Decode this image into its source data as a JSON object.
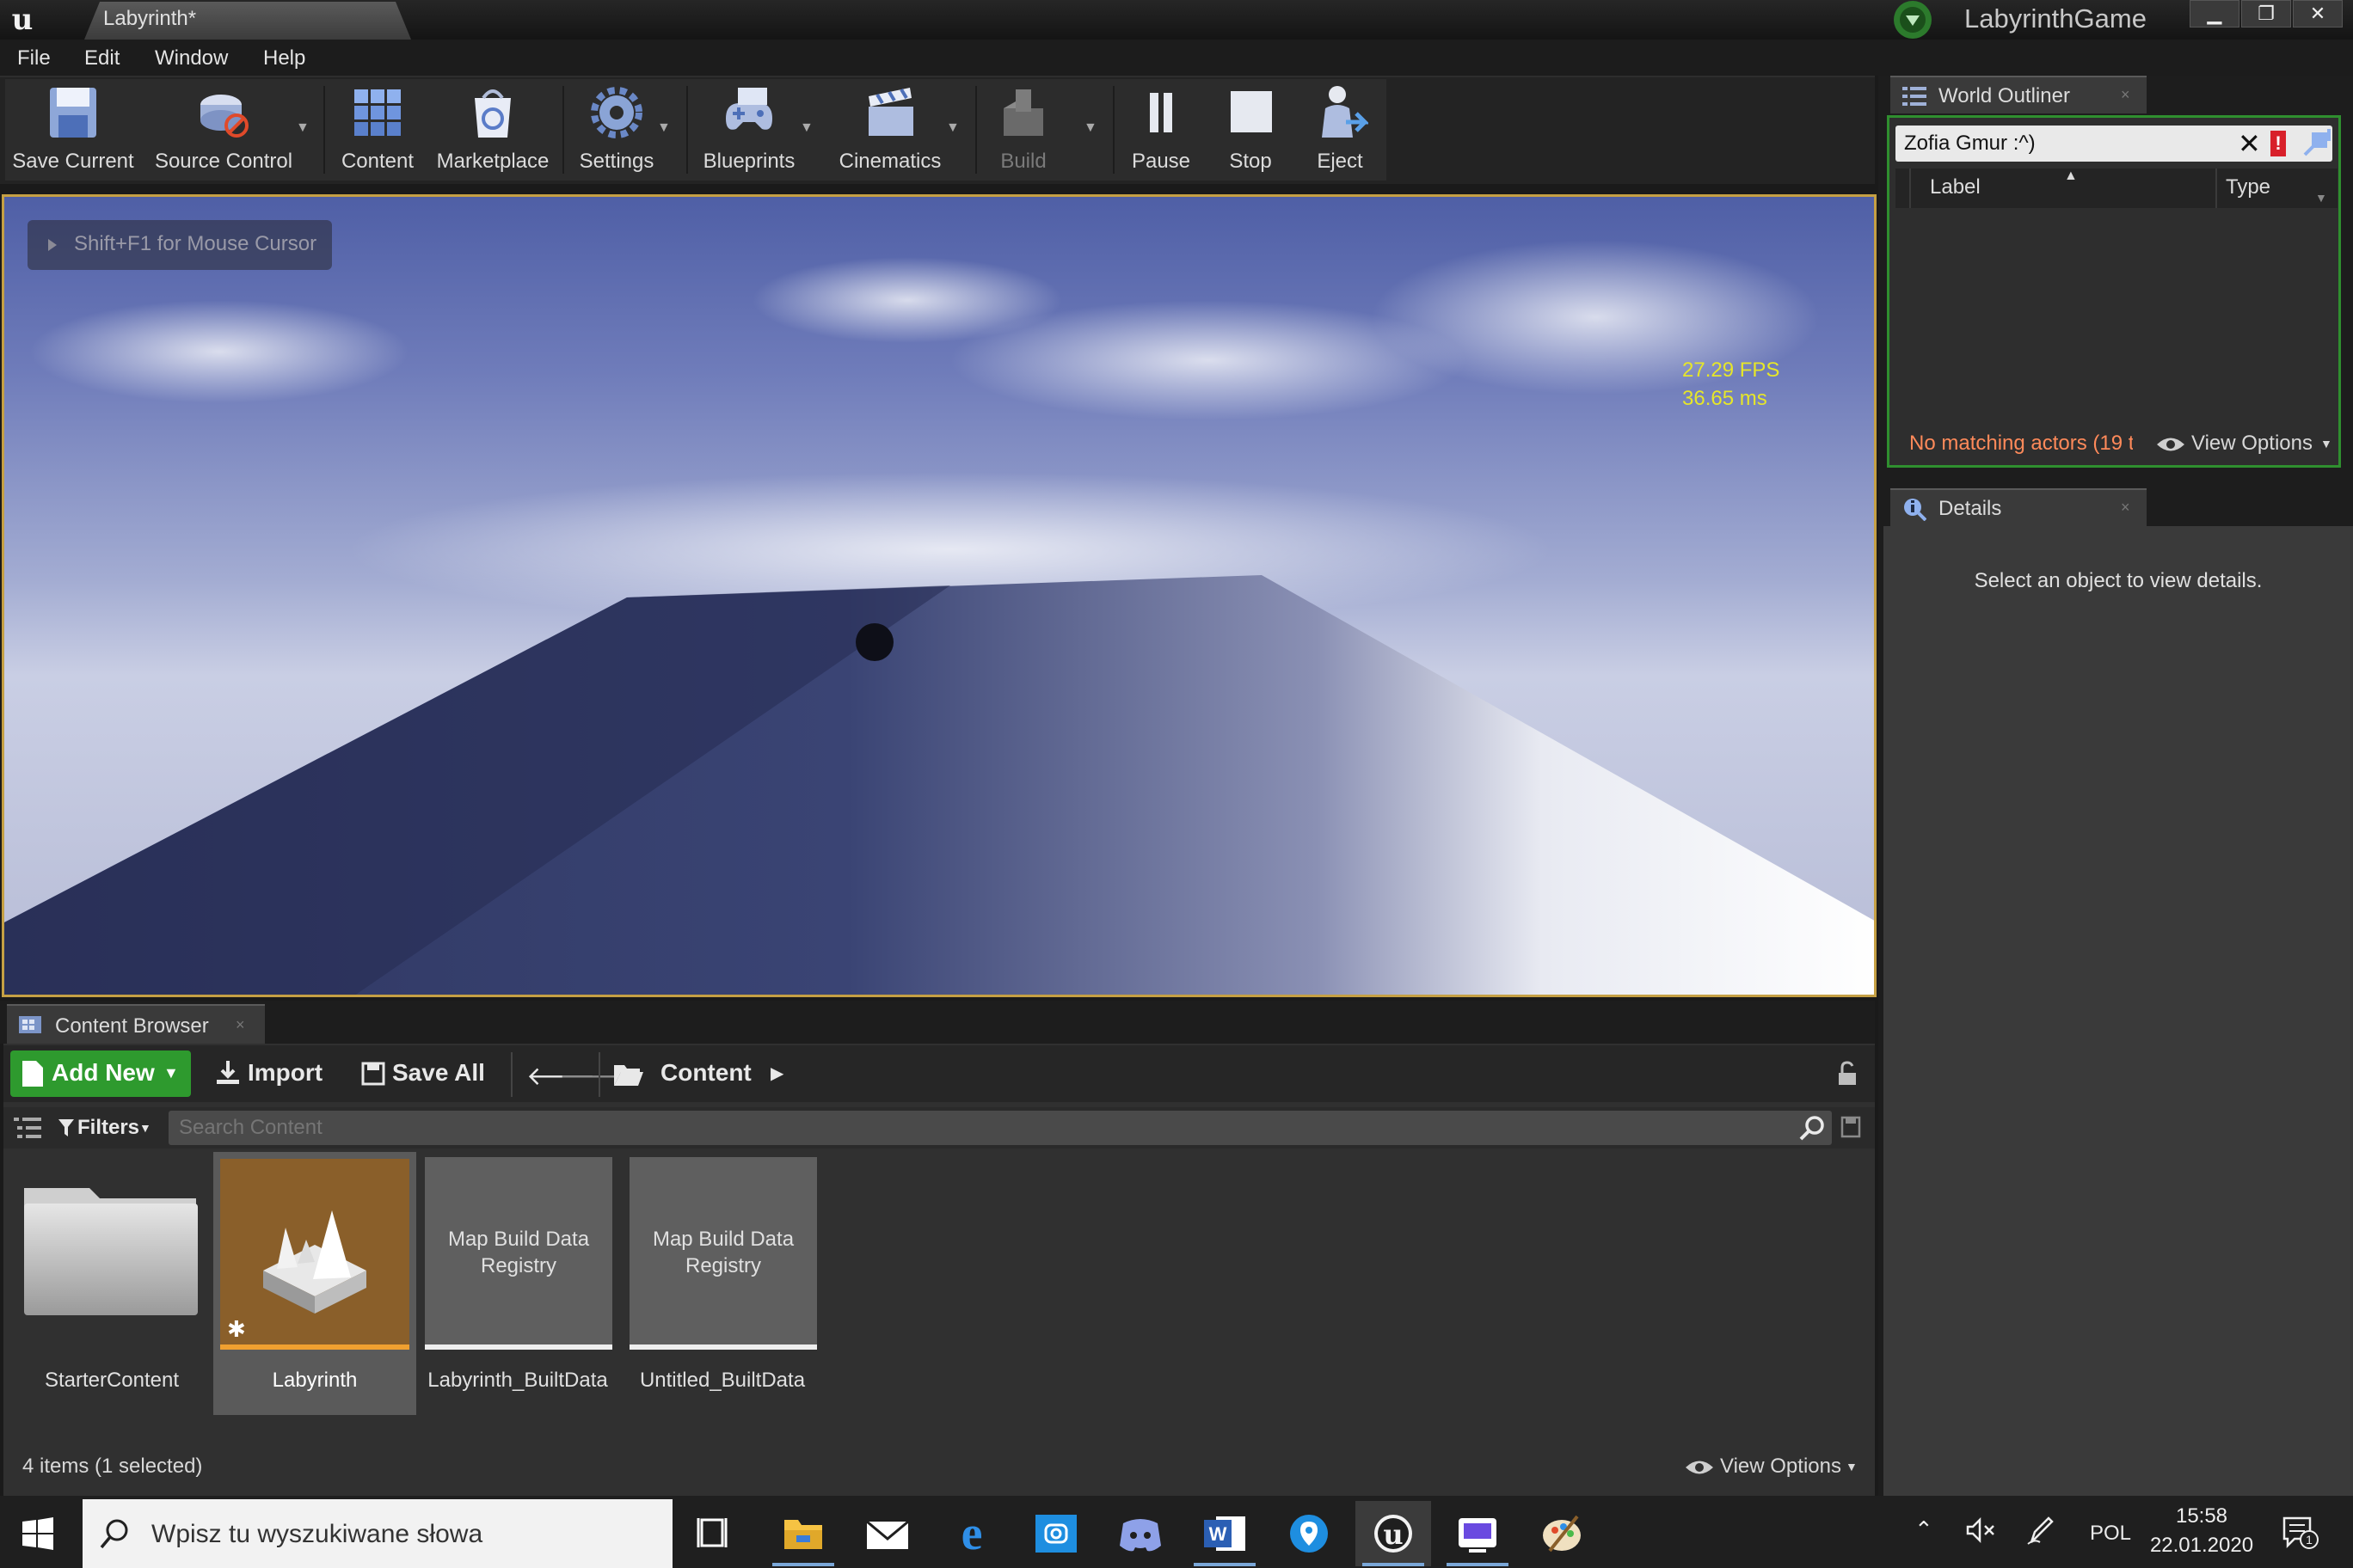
{
  "window": {
    "doc_tab": "Labyrinth*",
    "project": "LabyrinthGame",
    "controls": [
      "▁",
      "❐",
      "✕"
    ]
  },
  "menu": [
    "File",
    "Edit",
    "Window",
    "Help"
  ],
  "toolbar": {
    "buttons": [
      {
        "label": "Save Current",
        "icon": "save-icon"
      },
      {
        "label": "Source Control",
        "icon": "source-control-icon"
      },
      {
        "label": "Content",
        "icon": "content-icon"
      },
      {
        "label": "Marketplace",
        "icon": "marketplace-icon"
      },
      {
        "label": "Settings",
        "icon": "settings-icon"
      },
      {
        "label": "Blueprints",
        "icon": "blueprints-icon"
      },
      {
        "label": "Cinematics",
        "icon": "cinematics-icon"
      },
      {
        "label": "Build",
        "icon": "build-icon",
        "disabled": true
      },
      {
        "label": "Pause",
        "icon": "pause-icon"
      },
      {
        "label": "Stop",
        "icon": "stop-icon"
      },
      {
        "label": "Eject",
        "icon": "eject-icon"
      }
    ]
  },
  "viewport": {
    "cursor_hint": "Shift+F1 for Mouse Cursor",
    "fps": "27.29 FPS",
    "frame_ms": "36.65 ms"
  },
  "content_browser": {
    "tab_title": "Content Browser",
    "add_new": "Add New",
    "import": "Import",
    "save_all": "Save All",
    "path": "Content",
    "filters": "Filters",
    "search_placeholder": "Search Content",
    "assets": [
      {
        "name": "StarterContent",
        "type": "folder",
        "selected": false
      },
      {
        "name": "Labyrinth",
        "type": "level",
        "selected": true
      },
      {
        "name": "Labyrinth_BuiltData",
        "type": "registry",
        "thumb_text": "Map Build Data Registry",
        "selected": false
      },
      {
        "name": "Untitled_BuiltData",
        "type": "registry",
        "thumb_text": "Map Build Data Registry",
        "selected": false
      }
    ],
    "status": "4 items (1 selected)",
    "view_options": "View Options"
  },
  "world_outliner": {
    "tab_title": "World Outliner",
    "search_value": "Zofia Gmur :^)",
    "col_label": "Label",
    "col_type": "Type",
    "status": "No matching actors (19 t",
    "view_options": "View Options"
  },
  "details": {
    "tab_title": "Details",
    "empty_message": "Select an object to view details."
  },
  "taskbar": {
    "search_placeholder": "Wpisz tu wyszukiwane słowa",
    "apps": [
      "task-view-icon",
      "file-explorer-icon",
      "mail-icon",
      "edge-icon",
      "camera-app-icon",
      "discord-icon",
      "word-icon",
      "maps-icon",
      "unreal-engine-icon",
      "launcher-icon",
      "paint-icon"
    ],
    "language": "POL",
    "time": "15:58",
    "date": "22.01.2020",
    "notification_count": "1"
  },
  "colors": {
    "accent_green": "#2e9a2e",
    "viewport_border": "#c5a044",
    "fps_text": "#e6e629",
    "wo_status_text": "#ff8a5a"
  }
}
